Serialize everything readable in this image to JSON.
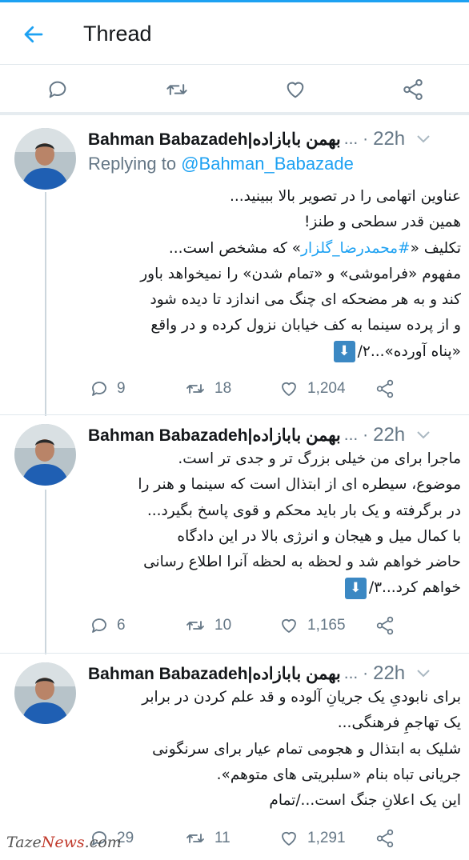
{
  "header": {
    "title": "Thread"
  },
  "action_bar": [
    "reply-icon",
    "retweet-icon",
    "like-icon",
    "share-icon"
  ],
  "colors": {
    "accent": "#1da1f2",
    "muted": "#657786",
    "text": "#14171a"
  },
  "tweets": [
    {
      "name": "Bahman Babazadeh|بهمن بابازاده",
      "meta": "... ·",
      "time": "22h",
      "reply_prefix": "Replying to",
      "reply_handle": "@Bahman_Babazade",
      "lines": [
        "عناوین اتهامی را در تصویر بالا ببینید...",
        "همین قدر سطحی و طنز!",
        "تکلیف «",
        "#محمدرضا_گلزار",
        "» که مشخص است...",
        "مفهوم «فراموشی» و «تمام شدن» را نمیخواهد باور",
        "کند و به هر مضحکه ای چنگ می اندازد تا دیده شود",
        "و از پرده سینما به کف خیابان نزول کرده و در واقع",
        "«پناه آورده»...۲/"
      ],
      "replies": "9",
      "retweets": "18",
      "likes": "1,204"
    },
    {
      "name": "Bahman Babazadeh|بهمن بابازاده",
      "meta": "... ·",
      "time": "22h",
      "lines": [
        "ماجرا برای من خیلی بزرگ تر و جدی تر است.",
        "موضوع، سیطره ای از ابتذال است که سینما و هنر را",
        "در برگرفته و یک بار باید محکم و قوی پاسخ بگیرد...",
        "با کمال میل و هیجان و انرژی بالا در این دادگاه",
        "حاضر خواهم شد و لحظه به لحظه آنرا اطلاع رسانی",
        "خواهم کرد...۳/"
      ],
      "replies": "6",
      "retweets": "10",
      "likes": "1,165"
    },
    {
      "name": "Bahman Babazadeh|بهمن بابازاده",
      "meta": "... ·",
      "time": "22h",
      "lines": [
        "برای نابودیِ یک جریانِ آلوده و قد علم کردن در برابر",
        "یک تهاجمِ فرهنگی...",
        "شلیک به ابتذال و هجومی تمام عیار برای سرنگونی",
        "جریانی تباه بنام «سلبریتی های متوهم».",
        "این یک اعلانِ جنگ است.../تمام"
      ],
      "replies": "29",
      "retweets": "11",
      "likes": "1,291"
    }
  ],
  "emoji": {
    "down_arrow": "⬇"
  },
  "watermark": {
    "part1": "Taze",
    "part2": "News",
    "part3": ".com"
  }
}
